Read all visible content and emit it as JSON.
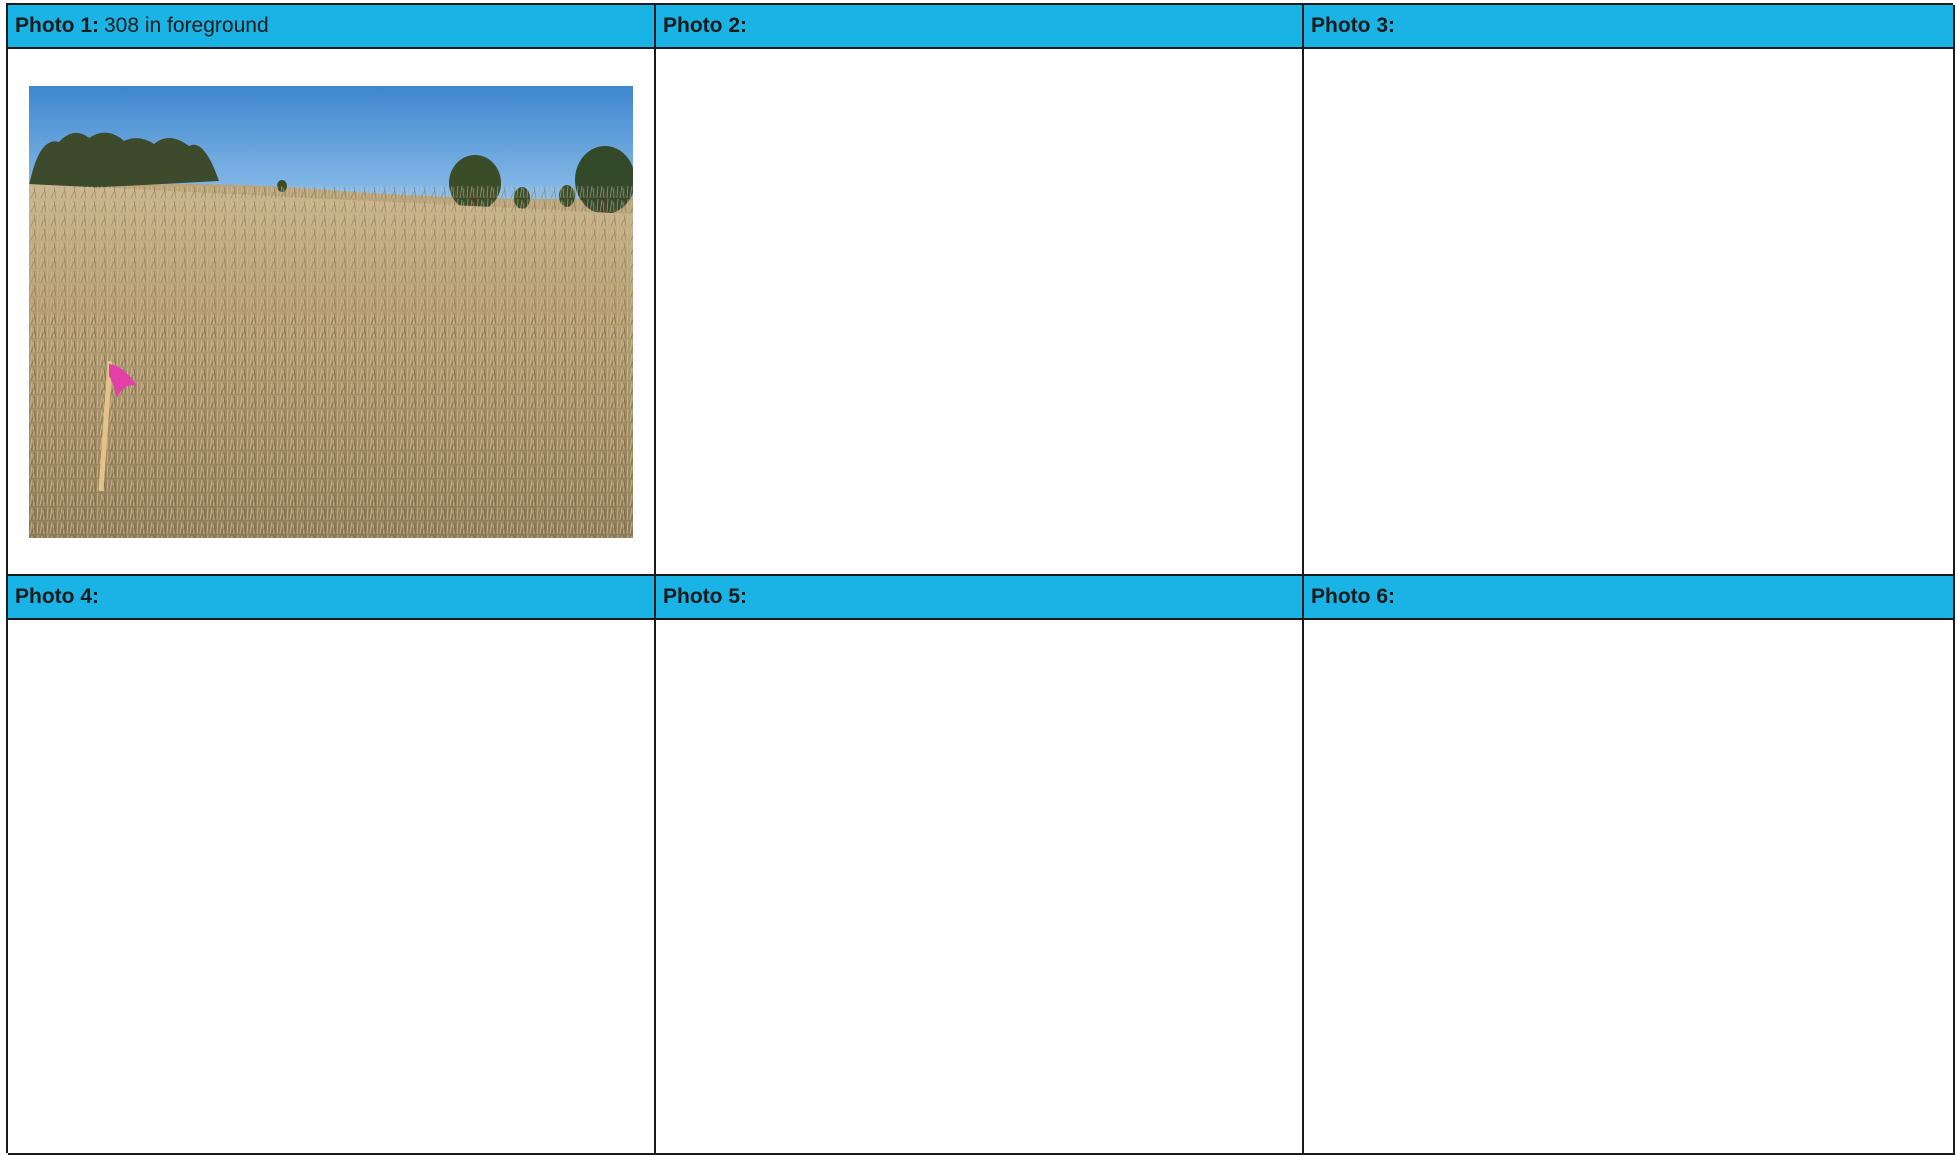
{
  "photos": [
    {
      "label": "Photo 1:",
      "caption": "308 in foreground",
      "has_image": true
    },
    {
      "label": "Photo 2:",
      "caption": "",
      "has_image": false
    },
    {
      "label": "Photo 3:",
      "caption": "",
      "has_image": false
    },
    {
      "label": "Photo 4:",
      "caption": "",
      "has_image": false
    },
    {
      "label": "Photo 5:",
      "caption": "",
      "has_image": false
    },
    {
      "label": "Photo 6:",
      "caption": "",
      "has_image": false
    }
  ],
  "colors": {
    "header_bg": "#19b4e5",
    "border": "#1a1a1a",
    "survey_flag": "#e23fa8"
  }
}
